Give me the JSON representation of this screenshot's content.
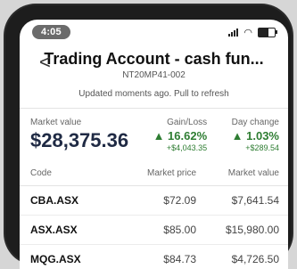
{
  "status_bar": {
    "time": "4:05"
  },
  "header": {
    "back_label": "<",
    "title": "Trading Account - cash fun...",
    "subtitle": "NT20MP41-002"
  },
  "refresh_note": "Updated moments ago. Pull to refresh",
  "summary": {
    "market_value_label": "Market value",
    "market_value": "$28,375.36",
    "gain_loss_label": "Gain/Loss",
    "gain_loss_pct": "▲ 16.62%",
    "gain_loss_amt": "+$4,043.35",
    "day_change_label": "Day change",
    "day_change_pct": "▲ 1.03%",
    "day_change_amt": "+$289.54",
    "positive_color": "#2e7d32"
  },
  "table": {
    "headers": [
      "Code",
      "Market price",
      "Market value"
    ],
    "rows": [
      {
        "code": "CBA.ASX",
        "price": "$72.09",
        "value": "$7,641.54"
      },
      {
        "code": "ASX.ASX",
        "price": "$85.00",
        "value": "$15,980.00"
      },
      {
        "code": "MQG.ASX",
        "price": "$84.73",
        "value": "$4,726.50"
      }
    ]
  }
}
